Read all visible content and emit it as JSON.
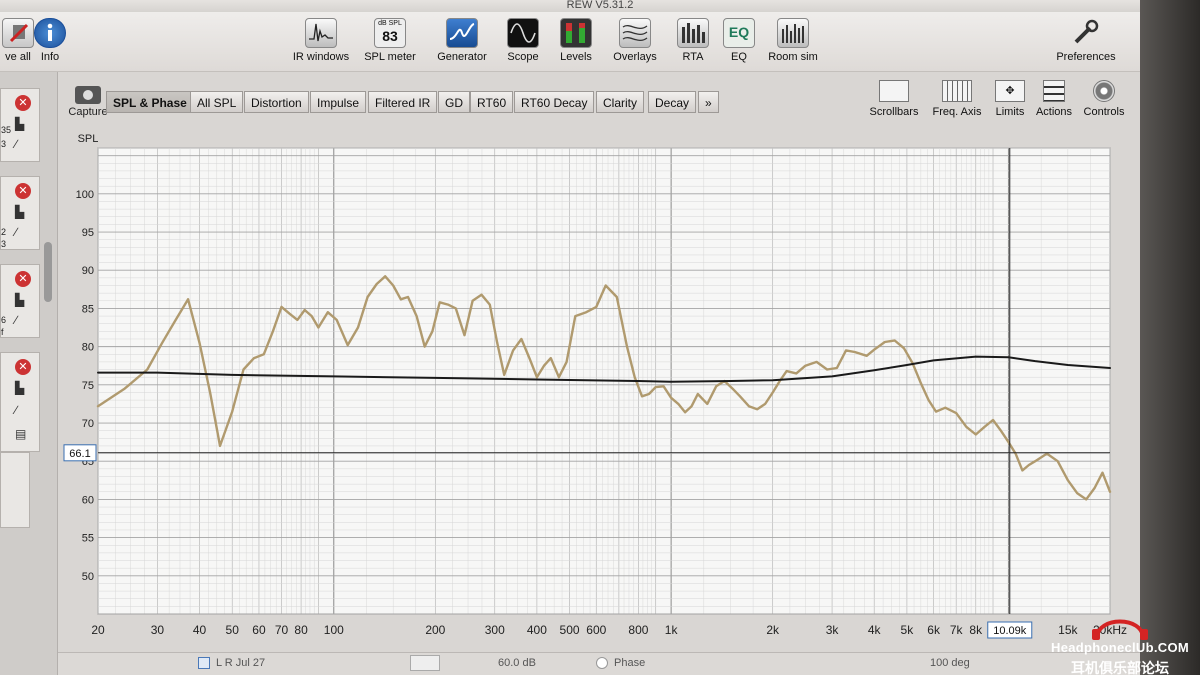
{
  "window": {
    "title": "REW V5.31.2"
  },
  "toolbar": {
    "left": [
      {
        "name": "save-all",
        "label": "ve all"
      },
      {
        "name": "info",
        "label": "Info"
      }
    ],
    "tools": [
      {
        "name": "ir-windows",
        "label": "IR windows"
      },
      {
        "name": "spl-meter",
        "label": "SPL meter",
        "badge_top": "dB SPL",
        "badge_value": "83"
      },
      {
        "name": "generator",
        "label": "Generator"
      },
      {
        "name": "scope",
        "label": "Scope"
      },
      {
        "name": "levels",
        "label": "Levels"
      },
      {
        "name": "overlays",
        "label": "Overlays"
      },
      {
        "name": "rta",
        "label": "RTA"
      },
      {
        "name": "eq",
        "label": "EQ",
        "icon_text": "EQ"
      },
      {
        "name": "room-sim",
        "label": "Room sim"
      }
    ],
    "preferences": "Preferences"
  },
  "capture": {
    "label": "Capture"
  },
  "tabs": [
    {
      "label": "SPL & Phase",
      "active": true
    },
    {
      "label": "All SPL"
    },
    {
      "label": "Distortion"
    },
    {
      "label": "Impulse"
    },
    {
      "label": "Filtered IR"
    },
    {
      "label": "GD"
    },
    {
      "label": "RT60"
    },
    {
      "label": "RT60 Decay"
    },
    {
      "label": "Clarity"
    },
    {
      "label": "Decay"
    },
    {
      "label": "»"
    }
  ],
  "graph_controls": [
    {
      "name": "scrollbars",
      "label": "Scrollbars"
    },
    {
      "name": "freq-axis",
      "label": "Freq. Axis"
    },
    {
      "name": "limits",
      "label": "Limits"
    },
    {
      "name": "actions",
      "label": "Actions"
    },
    {
      "name": "controls",
      "label": "Controls"
    }
  ],
  "measurements_panel": {
    "items": [
      {
        "line1": "35",
        "line2": "3"
      },
      {
        "line1": "2",
        "line2": "3"
      },
      {
        "line1": "6",
        "line2": "f"
      },
      {
        "line1": "",
        "line2": ""
      }
    ]
  },
  "bottom_bar": {
    "left_text": "L R  Jul 27",
    "mid_text": "60.0 dB",
    "phase_label": "Phase",
    "right_text": "100 deg"
  },
  "watermark": {
    "line1": "HeadphoneclUb.COM",
    "line2": "耳机俱乐部论坛"
  },
  "chart_data": {
    "type": "line",
    "ylabel": "SPL",
    "x_scale": "log",
    "xlim": [
      20,
      20000
    ],
    "ylim": [
      45,
      106
    ],
    "y_ticks": [
      50,
      55,
      60,
      65,
      70,
      75,
      80,
      85,
      90,
      95,
      100
    ],
    "x_tick_labels": [
      {
        "v": 20,
        "t": "20"
      },
      {
        "v": 30,
        "t": "30"
      },
      {
        "v": 40,
        "t": "40"
      },
      {
        "v": 50,
        "t": "50"
      },
      {
        "v": 60,
        "t": "60"
      },
      {
        "v": 70,
        "t": "70"
      },
      {
        "v": 80,
        "t": "80"
      },
      {
        "v": 100,
        "t": "100"
      },
      {
        "v": 200,
        "t": "200"
      },
      {
        "v": 300,
        "t": "300"
      },
      {
        "v": 400,
        "t": "400"
      },
      {
        "v": 500,
        "t": "500"
      },
      {
        "v": 600,
        "t": "600"
      },
      {
        "v": 800,
        "t": "800"
      },
      {
        "v": 1000,
        "t": "1k"
      },
      {
        "v": 2000,
        "t": "2k"
      },
      {
        "v": 3000,
        "t": "3k"
      },
      {
        "v": 4000,
        "t": "4k"
      },
      {
        "v": 5000,
        "t": "5k"
      },
      {
        "v": 6000,
        "t": "6k"
      },
      {
        "v": 7000,
        "t": "7k"
      },
      {
        "v": 8000,
        "t": "8k"
      },
      {
        "v": 15000,
        "t": "15k"
      },
      {
        "v": 20000,
        "t": "20kHz"
      }
    ],
    "grid": true,
    "cursor": {
      "freq": 10090,
      "freq_label": "10.09k",
      "spl": 66.1,
      "spl_label": "66.1"
    },
    "colors": {
      "measured": "#b09a6e",
      "smooth": "#1a1a1a",
      "grid": "#b8b8b8",
      "plot_bg": "#f7f7f6"
    },
    "series": [
      {
        "key": "measured",
        "x": [
          20,
          24,
          28,
          31,
          34,
          37,
          40,
          43,
          46,
          50,
          54,
          58,
          62,
          66,
          70,
          74,
          78,
          82,
          86,
          90,
          96,
          102,
          110,
          118,
          126,
          134,
          142,
          150,
          158,
          166,
          176,
          186,
          196,
          206,
          218,
          230,
          244,
          258,
          274,
          290,
          305,
          320,
          340,
          360,
          380,
          400,
          420,
          440,
          465,
          490,
          520,
          560,
          600,
          640,
          690,
          740,
          780,
          820,
          860,
          900,
          950,
          1000,
          1050,
          1100,
          1150,
          1200,
          1280,
          1360,
          1440,
          1520,
          1600,
          1700,
          1800,
          1900,
          2000,
          2100,
          2200,
          2350,
          2500,
          2700,
          2900,
          3100,
          3300,
          3500,
          3800,
          4000,
          4300,
          4600,
          4900,
          5200,
          5500,
          5800,
          6100,
          6500,
          7000,
          7500,
          8000,
          8500,
          9000,
          9500,
          10000,
          10500,
          11000,
          11500,
          12000,
          13000,
          14000,
          15000,
          16000,
          17000,
          18000,
          19000,
          20000
        ],
        "y": [
          72.2,
          74.5,
          77,
          80.5,
          83.5,
          86.2,
          80.5,
          74,
          67,
          71.5,
          77,
          78.5,
          79,
          82,
          85.2,
          84.3,
          83.5,
          84.8,
          84,
          82.5,
          84.5,
          83.5,
          80.2,
          82.5,
          86.5,
          88.2,
          89.2,
          88,
          86.2,
          86.5,
          84,
          80,
          82,
          85.8,
          85.5,
          85,
          81.5,
          86,
          86.8,
          85.5,
          80.5,
          76.3,
          79.5,
          81,
          78.5,
          76,
          77.5,
          78.5,
          76,
          78,
          84,
          84.5,
          85.2,
          88,
          86.5,
          80,
          76,
          73.5,
          73.8,
          74.7,
          74.8,
          73.3,
          72.5,
          71.4,
          72.2,
          73.8,
          72.5,
          74.8,
          75.5,
          74.5,
          73.5,
          72.2,
          71.8,
          72.5,
          74,
          75.5,
          76.8,
          76.5,
          77.5,
          78,
          77,
          77.2,
          79.5,
          79.3,
          78.8,
          79.6,
          80.6,
          80.8,
          79.8,
          77.8,
          75.2,
          73,
          71.5,
          72,
          71.3,
          69.5,
          68.5,
          69.5,
          70.4,
          69,
          67.5,
          66,
          63.8,
          64.5,
          65,
          66,
          65,
          62.5,
          60.8,
          60,
          61.5,
          63.5,
          61
        ]
      },
      {
        "key": "smooth",
        "x": [
          20,
          30,
          50,
          100,
          200,
          400,
          800,
          1000,
          1500,
          2000,
          3000,
          4000,
          5000,
          6000,
          8000,
          10000,
          12000,
          15000,
          20000
        ],
        "y": [
          76.6,
          76.6,
          76.3,
          76.1,
          75.9,
          75.7,
          75.5,
          75.4,
          75.5,
          75.6,
          76.1,
          76.9,
          77.6,
          78.2,
          78.7,
          78.6,
          78.1,
          77.6,
          77.2
        ]
      }
    ]
  }
}
